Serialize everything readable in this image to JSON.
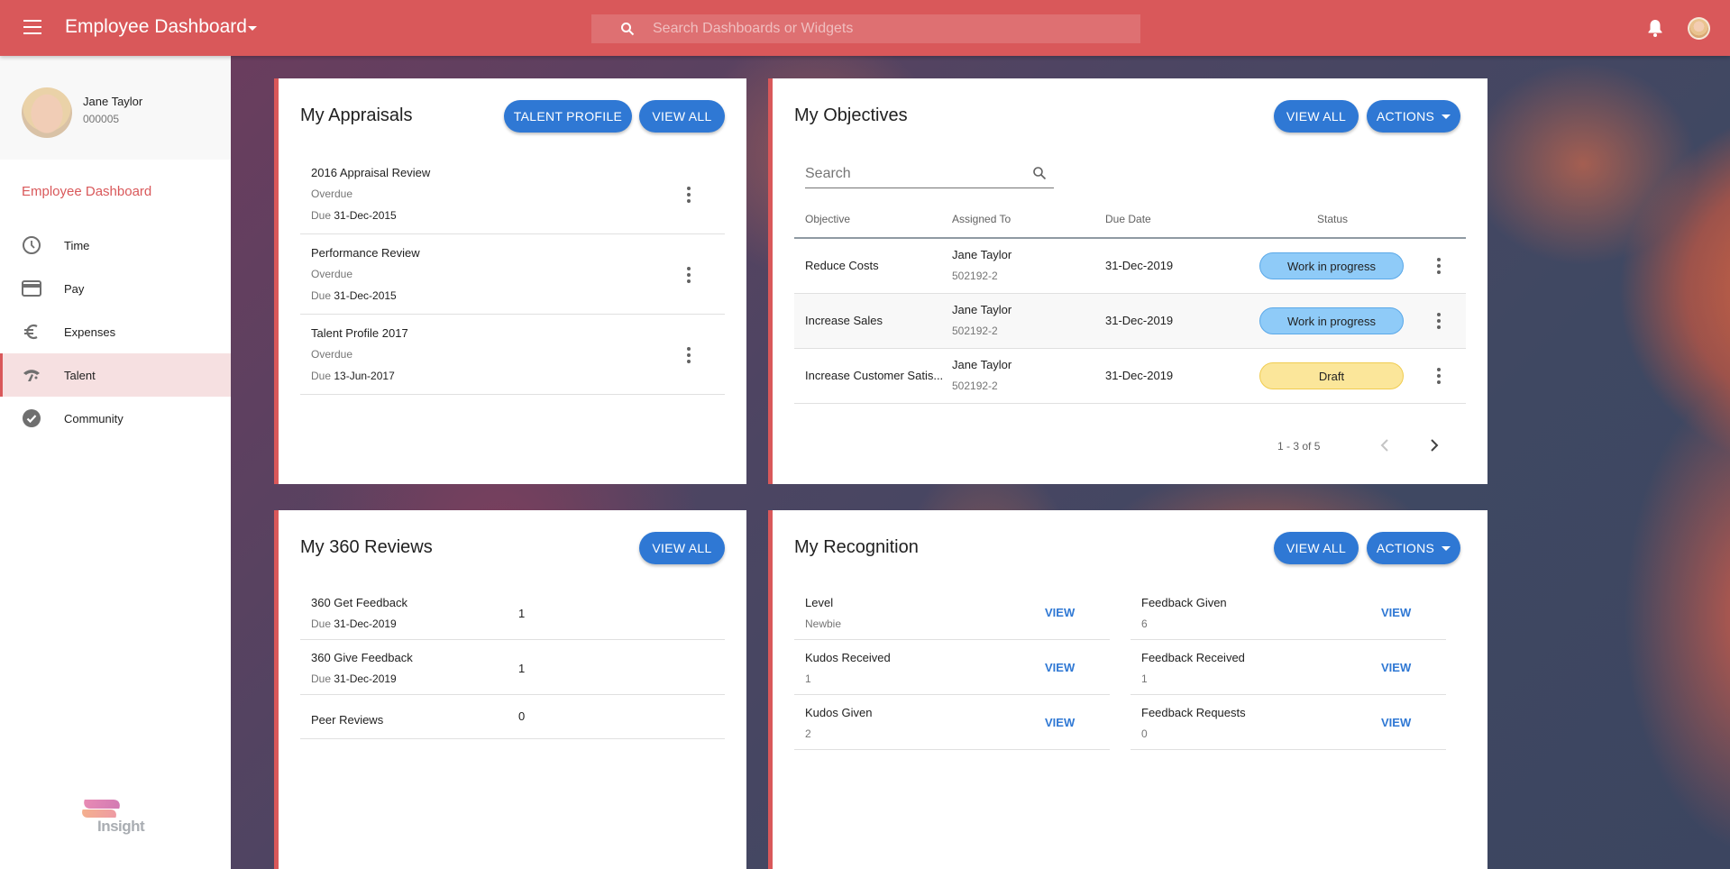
{
  "header": {
    "app_title": "Employee Dashboard",
    "search_placeholder": "Search Dashboards or Widgets"
  },
  "sidebar": {
    "profile": {
      "name": "Jane Taylor",
      "employee_id": "000005"
    },
    "dashboard_link": "Employee Dashboard",
    "items": [
      {
        "label": "Time",
        "icon": "clock-icon",
        "active": false
      },
      {
        "label": "Pay",
        "icon": "credit-card-icon",
        "active": false
      },
      {
        "label": "Expenses",
        "icon": "euro-icon",
        "active": false
      },
      {
        "label": "Talent",
        "icon": "talent-icon",
        "active": true
      },
      {
        "label": "Community",
        "icon": "check-circle-icon",
        "active": false
      }
    ],
    "logo_text": "Insight"
  },
  "appraisals": {
    "title": "My Appraisals",
    "buttons": {
      "talent_profile": "TALENT PROFILE",
      "view_all": "VIEW ALL"
    },
    "due_prefix": "Due",
    "items": [
      {
        "name": "2016 Appraisal Review",
        "status": "Overdue",
        "due": "31-Dec-2015"
      },
      {
        "name": "Performance Review",
        "status": "Overdue",
        "due": "31-Dec-2015"
      },
      {
        "name": "Talent Profile 2017",
        "status": "Overdue",
        "due": "13-Jun-2017"
      }
    ]
  },
  "objectives": {
    "title": "My Objectives",
    "buttons": {
      "view_all": "VIEW ALL",
      "actions": "ACTIONS"
    },
    "search_placeholder": "Search",
    "columns": [
      "Objective",
      "Assigned To",
      "Due Date",
      "Status"
    ],
    "rows": [
      {
        "objective": "Reduce Costs",
        "assignee": "Jane Taylor",
        "assignee_id": "502192-2",
        "due": "31-Dec-2019",
        "status": "Work in progress",
        "status_type": "wip"
      },
      {
        "objective": "Increase Sales",
        "assignee": "Jane Taylor",
        "assignee_id": "502192-2",
        "due": "31-Dec-2019",
        "status": "Work in progress",
        "status_type": "wip"
      },
      {
        "objective": "Increase Customer Satis...",
        "assignee": "Jane Taylor",
        "assignee_id": "502192-2",
        "due": "31-Dec-2019",
        "status": "Draft",
        "status_type": "draft"
      }
    ],
    "pagination": {
      "range": "1 - 3 of 5"
    }
  },
  "reviews": {
    "title": "My 360 Reviews",
    "buttons": {
      "view_all": "VIEW ALL"
    },
    "due_prefix": "Due",
    "items": [
      {
        "name": "360 Get Feedback",
        "due": "31-Dec-2019",
        "count": "1"
      },
      {
        "name": "360 Give Feedback",
        "due": "31-Dec-2019",
        "count": "1"
      },
      {
        "name": "Peer Reviews",
        "due": null,
        "count": "0"
      }
    ]
  },
  "recognition": {
    "title": "My Recognition",
    "buttons": {
      "view_all": "VIEW ALL",
      "actions": "ACTIONS"
    },
    "view_label": "VIEW",
    "left": [
      {
        "label": "Level",
        "value": "Newbie"
      },
      {
        "label": "Kudos Received",
        "value": "1"
      },
      {
        "label": "Kudos Given",
        "value": "2"
      }
    ],
    "right": [
      {
        "label": "Feedback Given",
        "value": "6"
      },
      {
        "label": "Feedback Received",
        "value": "1"
      },
      {
        "label": "Feedback Requests",
        "value": "0"
      }
    ]
  },
  "colors": {
    "brand": "#d9585a",
    "primary_button": "#2f78d4",
    "status_wip": "#8fcbf8",
    "status_draft": "#fbe69a",
    "active_nav_bg": "#f6e0e1"
  }
}
